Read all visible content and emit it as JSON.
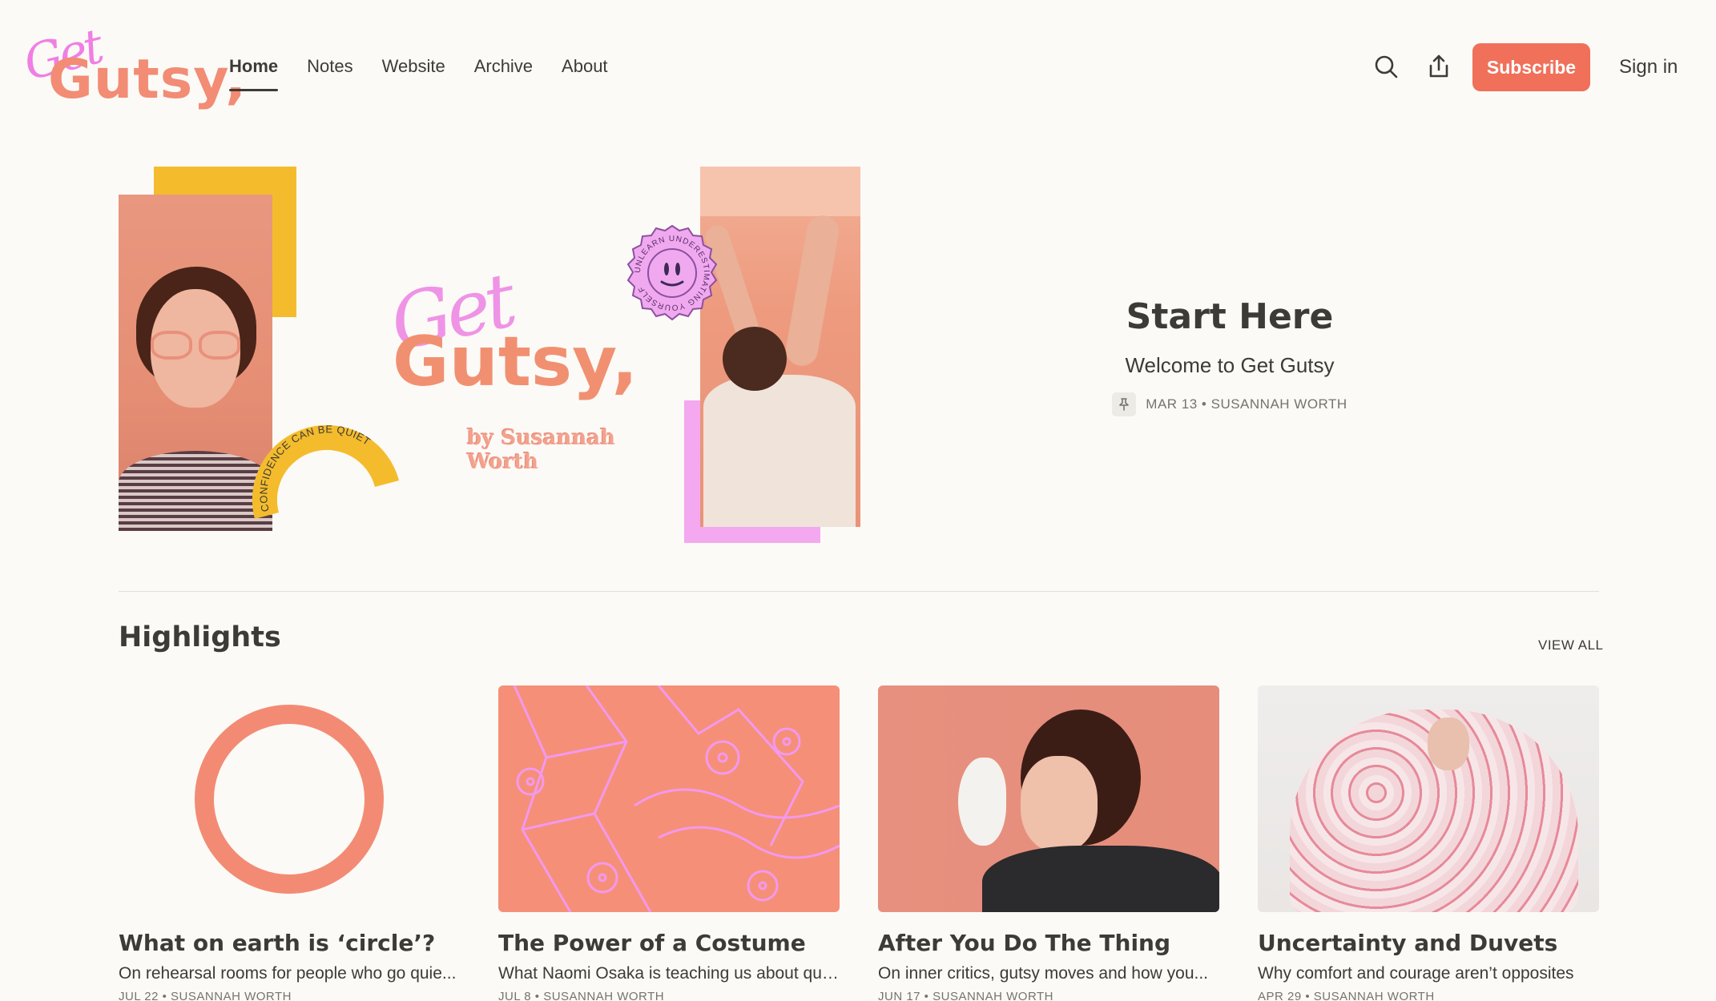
{
  "brand": {
    "logo_get": "Get",
    "logo_gutsy": "Gutsy,"
  },
  "nav": {
    "items": [
      {
        "label": "Home",
        "active": true
      },
      {
        "label": "Notes"
      },
      {
        "label": "Website"
      },
      {
        "label": "Archive"
      },
      {
        "label": "About"
      }
    ]
  },
  "header": {
    "search_icon": "search-icon",
    "share_icon": "share-icon",
    "subscribe_label": "Subscribe",
    "signin_label": "Sign in"
  },
  "hero": {
    "art_get": "Get",
    "art_gutsy": "Gutsy,",
    "art_byline": "by Susannah Worth",
    "arch_text": "CONFIDENCE CAN BE QUIET",
    "badge_text": "UNLEARN UNDERESTIMATING YOURSELF"
  },
  "featured": {
    "title": "Start Here",
    "subtitle": "Welcome to Get Gutsy",
    "meta": "MAR 13 • SUSANNAH WORTH",
    "pin_icon": "pin-icon"
  },
  "highlights": {
    "heading": "Highlights",
    "view_all": "VIEW ALL",
    "posts": [
      {
        "title": "What on earth is ‘circle’?",
        "subtitle": "On rehearsal rooms for people who go quie...",
        "meta": "JUL 22 • SUSANNAH WORTH"
      },
      {
        "title": "The Power of a Costume",
        "subtitle": "What Naomi Osaka is teaching us about qui...",
        "meta": "JUL 8 • SUSANNAH WORTH"
      },
      {
        "title": "After You Do The Thing",
        "subtitle": "On inner critics, gutsy moves and how you...",
        "meta": "JUN 17 • SUSANNAH WORTH"
      },
      {
        "title": "Uncertainty and Duvets",
        "subtitle": "Why comfort and courage aren’t opposites",
        "meta": "APR 29 • SUSANNAH WORTH"
      }
    ]
  },
  "colors": {
    "accent": "#f0705a",
    "background": "#fbfaf6",
    "logo_pink": "#f07fe4",
    "logo_coral": "#f28c74",
    "yellow": "#f4bc2c"
  }
}
